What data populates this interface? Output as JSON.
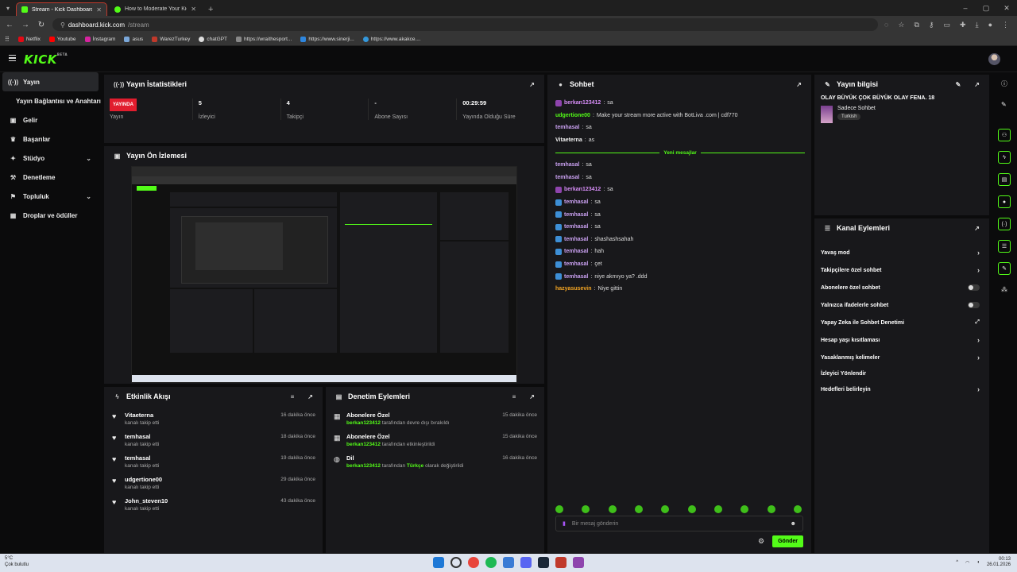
{
  "browser": {
    "tabs": [
      {
        "title": "Stream - Kick Dashboard",
        "active": true
      },
      {
        "title": "How to Moderate Your Kick Ch",
        "active": false
      }
    ],
    "url_host": "dashboard.kick.com",
    "url_path": "/stream",
    "bookmarks": [
      "Netflix",
      "Youtube",
      "İnstagram",
      "asus",
      "WarezTurkey",
      "chatGPT",
      "https://wraithesport...",
      "https://www.sinerji...",
      "https://www.akakce...."
    ]
  },
  "app": {
    "logo": "KICK",
    "logo_beta": "BETA"
  },
  "sidebar": {
    "items": [
      {
        "label": "Yayın",
        "icon": "broadcast-icon"
      },
      {
        "label": "Yayın Bağlantısı ve Anahtarı",
        "icon": ""
      },
      {
        "label": "Gelir",
        "icon": "wallet-icon"
      },
      {
        "label": "Başarılar",
        "icon": "trophy-icon"
      },
      {
        "label": "Stüdyo",
        "icon": "studio-icon"
      },
      {
        "label": "Denetleme",
        "icon": "moderation-icon"
      },
      {
        "label": "Topluluk",
        "icon": "community-icon"
      },
      {
        "label": "Droplar ve ödüller",
        "icon": "drops-icon"
      }
    ]
  },
  "stats": {
    "title": "Yayın İstatistikleri",
    "live_badge": "YAYINDA",
    "items": [
      {
        "value": "",
        "label": "Yayın"
      },
      {
        "value": "5",
        "label": "İzleyici"
      },
      {
        "value": "4",
        "label": "Takipçi"
      },
      {
        "value": "-",
        "label": "Abone Sayısı"
      },
      {
        "value": "00:29:59",
        "label": "Yayında Olduğu Süre"
      }
    ]
  },
  "preview": {
    "title": "Yayın Ön İzlemesi"
  },
  "activity": {
    "title": "Etkinlik Akışı",
    "items": [
      {
        "name": "Vitaeterna",
        "desc": "kanalı takip etti",
        "time": "16 dakika önce"
      },
      {
        "name": "temhasal",
        "desc": "kanalı takip etti",
        "time": "18 dakika önce"
      },
      {
        "name": "temhasal",
        "desc": "kanalı takip etti",
        "time": "19 dakika önce"
      },
      {
        "name": "udgertione00",
        "desc": "kanalı takip etti",
        "time": "29 dakika önce"
      },
      {
        "name": "John_steven10",
        "desc": "kanalı takip etti",
        "time": "43 dakika önce"
      }
    ]
  },
  "modactions": {
    "title": "Denetim Eylemleri",
    "items": [
      {
        "name": "Abonelere Özel",
        "user": "berkan123412",
        "desc": "tarafından devre dışı bırakıldı",
        "time": "15 dakika önce",
        "extra": ""
      },
      {
        "name": "Abonelere Özel",
        "user": "berkan123412",
        "desc": "tarafından etkinleştirildi",
        "time": "15 dakika önce",
        "extra": ""
      },
      {
        "name": "Dil",
        "user": "berkan123412",
        "desc": "tarafından",
        "extra": "Türkçe",
        "desc2": "olarak değiştirildi",
        "time": "16 dakika önce"
      }
    ]
  },
  "chat": {
    "title": "Sohbet",
    "new_messages": "Yeni mesajlar",
    "messages_top": [
      {
        "user": "berkan123412",
        "text": "sa",
        "color": "#d58cf5",
        "badge": "#8e44ad"
      },
      {
        "user": "udgertione00",
        "text": "Make your stream more active with BotLiva .com | cdf770",
        "color": "#53fc18",
        "badge": ""
      },
      {
        "user": "temhasal",
        "text": "sa",
        "color": "#c9a0f0",
        "badge": ""
      },
      {
        "user": "Vitaeterna",
        "text": "as",
        "color": "#f0f0f0",
        "badge": ""
      }
    ],
    "messages_bottom": [
      {
        "user": "temhasal",
        "text": "sa",
        "color": "#c9a0f0",
        "badge": ""
      },
      {
        "user": "temhasal",
        "text": "sa",
        "color": "#c9a0f0",
        "badge": ""
      },
      {
        "user": "berkan123412",
        "text": "sa",
        "color": "#d58cf5",
        "badge": "#8e44ad"
      },
      {
        "user": "temhasal",
        "text": "sa",
        "color": "#c9a0f0",
        "badge": "#3d8fd6"
      },
      {
        "user": "temhasal",
        "text": "sa",
        "color": "#c9a0f0",
        "badge": "#3d8fd6"
      },
      {
        "user": "temhasal",
        "text": "sa",
        "color": "#c9a0f0",
        "badge": "#3d8fd6"
      },
      {
        "user": "temhasal",
        "text": "shashashsahah",
        "color": "#c9a0f0",
        "badge": "#3d8fd6"
      },
      {
        "user": "temhasal",
        "text": "hah",
        "color": "#c9a0f0",
        "badge": "#3d8fd6"
      },
      {
        "user": "temhasal",
        "text": "çet",
        "color": "#c9a0f0",
        "badge": "#3d8fd6"
      },
      {
        "user": "temhasal",
        "text": "niye akmıyo ya? .ddd",
        "color": "#c9a0f0",
        "badge": "#3d8fd6"
      },
      {
        "user": "hazyasusevin",
        "text": "Niye gittin",
        "color": "#f5a623",
        "badge": ""
      }
    ],
    "input_placeholder": "Bir mesaj gönderin",
    "send_label": "Gönder"
  },
  "streaminfo": {
    "title": "Yayın bilgisi",
    "stream_title": "OLAY BÜYÜK ÇOK BÜYÜK OLAY FENA. 18",
    "category": "Sadece Sohbet",
    "tag": "Turkish"
  },
  "channelactions": {
    "title": "Kanal Eylemleri",
    "items": [
      {
        "label": "Yavaş mod",
        "type": "chevron"
      },
      {
        "label": "Takipçilere özel sohbet",
        "type": "chevron"
      },
      {
        "label": "Abonelere özel sohbet",
        "type": "toggle"
      },
      {
        "label": "Yalnızca ifadelerle sohbet",
        "type": "toggle"
      },
      {
        "label": "Yapay Zeka ile Sohbet Denetimi",
        "type": "external"
      },
      {
        "label": "Hesap yaşı kısıtlaması",
        "type": "chevron"
      },
      {
        "label": "Yasaklanmış kelimeler",
        "type": "chevron"
      },
      {
        "label": "İzleyici Yönlendir",
        "type": "none"
      },
      {
        "label": "Hedefleri belirleyin",
        "type": "chevron"
      }
    ]
  },
  "taskbar": {
    "temp": "5°C",
    "weather": "Çok bulutlu",
    "time": "00:13",
    "date": "26.01.2026"
  },
  "colors": {
    "accent": "#53fc18",
    "panel": "#18181b",
    "live": "#e11d2e"
  }
}
